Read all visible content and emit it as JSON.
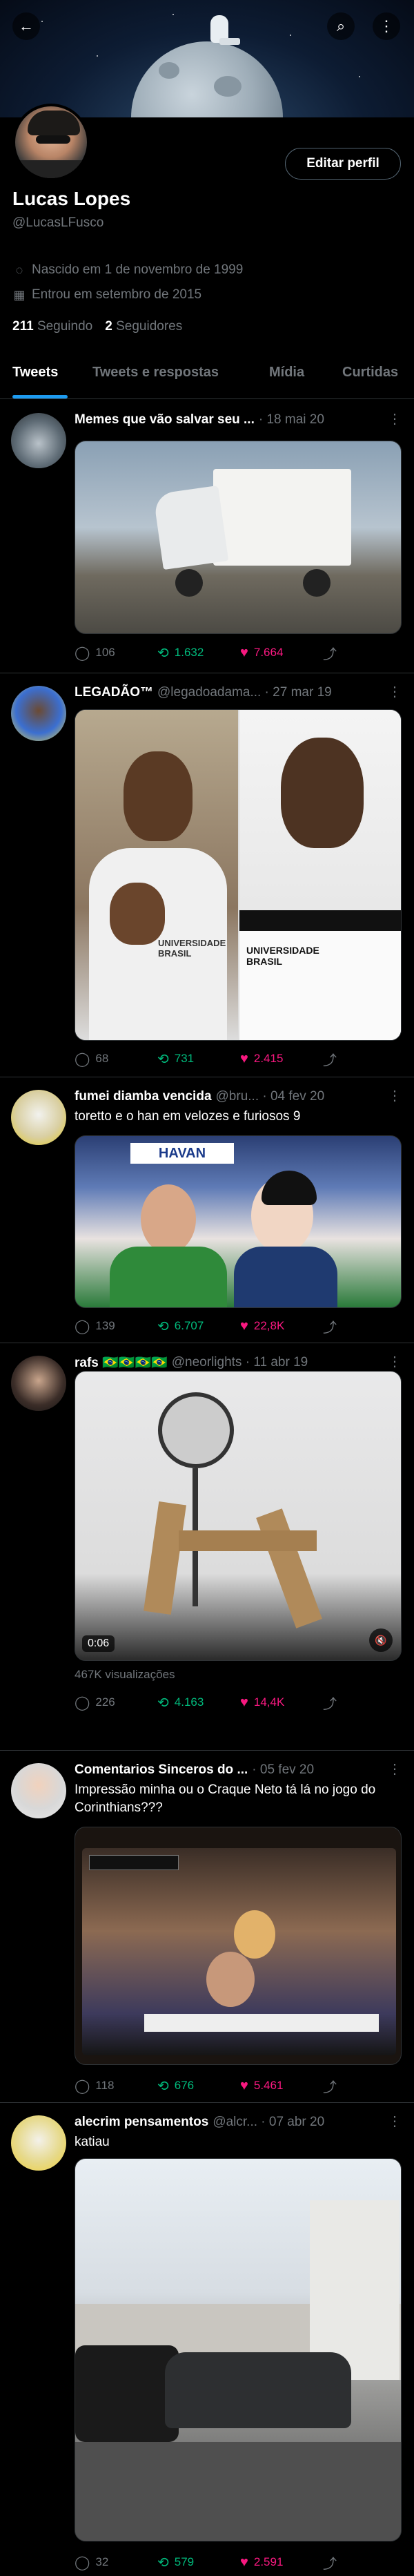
{
  "profile": {
    "name": "Lucas Lopes",
    "handle": "@LucasLFusco",
    "born": "Nascido em 1 de novembro de 1999",
    "joined": "Entrou em setembro de 2015",
    "following_count": "211",
    "following_label": "Seguindo",
    "followers_count": "2",
    "followers_label": "Seguidores",
    "edit_label": "Editar perfil"
  },
  "tabs": [
    "Tweets",
    "Tweets e respostas",
    "Mídia",
    "Curtidas"
  ],
  "icons": {
    "back": "←",
    "search": "⌕",
    "more": "⋮",
    "location": "◌",
    "calendar": "▦",
    "reply": "◯",
    "retweet": "⟲",
    "like": "♥",
    "share": "⤴",
    "mute": "🔇"
  },
  "tweets": [
    {
      "name": "Memes que vão salvar seu ...",
      "sub": "· 18 mai 20",
      "text": "",
      "replies": "106",
      "retweets": "1.632",
      "likes": "7.664"
    },
    {
      "name": "LEGADÃO™",
      "sub": "@legadoadama... · 27 mar 19",
      "text": "",
      "replies": "68",
      "retweets": "731",
      "likes": "2.415",
      "media_text_left": "UNIVERSIDADE BRASIL",
      "media_text_right": "UNIVERSIDADE BRASIL"
    },
    {
      "name": "fumei diamba vencida",
      "sub": "@bru... · 04 fev 20",
      "text": "toretto e o han em velozes e furiosos 9",
      "replies": "139",
      "retweets": "6.707",
      "likes": "22,8K",
      "media_text": "HAVAN"
    },
    {
      "name": "rafs 🇧🇷🇧🇷🇧🇷🇧🇷",
      "sub": "@neorlights · 11 abr 19",
      "text": "",
      "replies": "226",
      "retweets": "4.163",
      "likes": "14,4K",
      "video_time": "0:06",
      "views": "467K visualizações"
    },
    {
      "name": "Comentarios Sinceros do ...",
      "sub": "· 05 fev 20",
      "text": "Impressão minha ou o Craque Neto tá lá no jogo do Corinthians???",
      "replies": "118",
      "retweets": "676",
      "likes": "5.461"
    },
    {
      "name": "alecrim pensamentos",
      "sub": "@alcr... · 07 abr 20",
      "text": "katiau",
      "replies": "32",
      "retweets": "579",
      "likes": "2.591"
    }
  ]
}
